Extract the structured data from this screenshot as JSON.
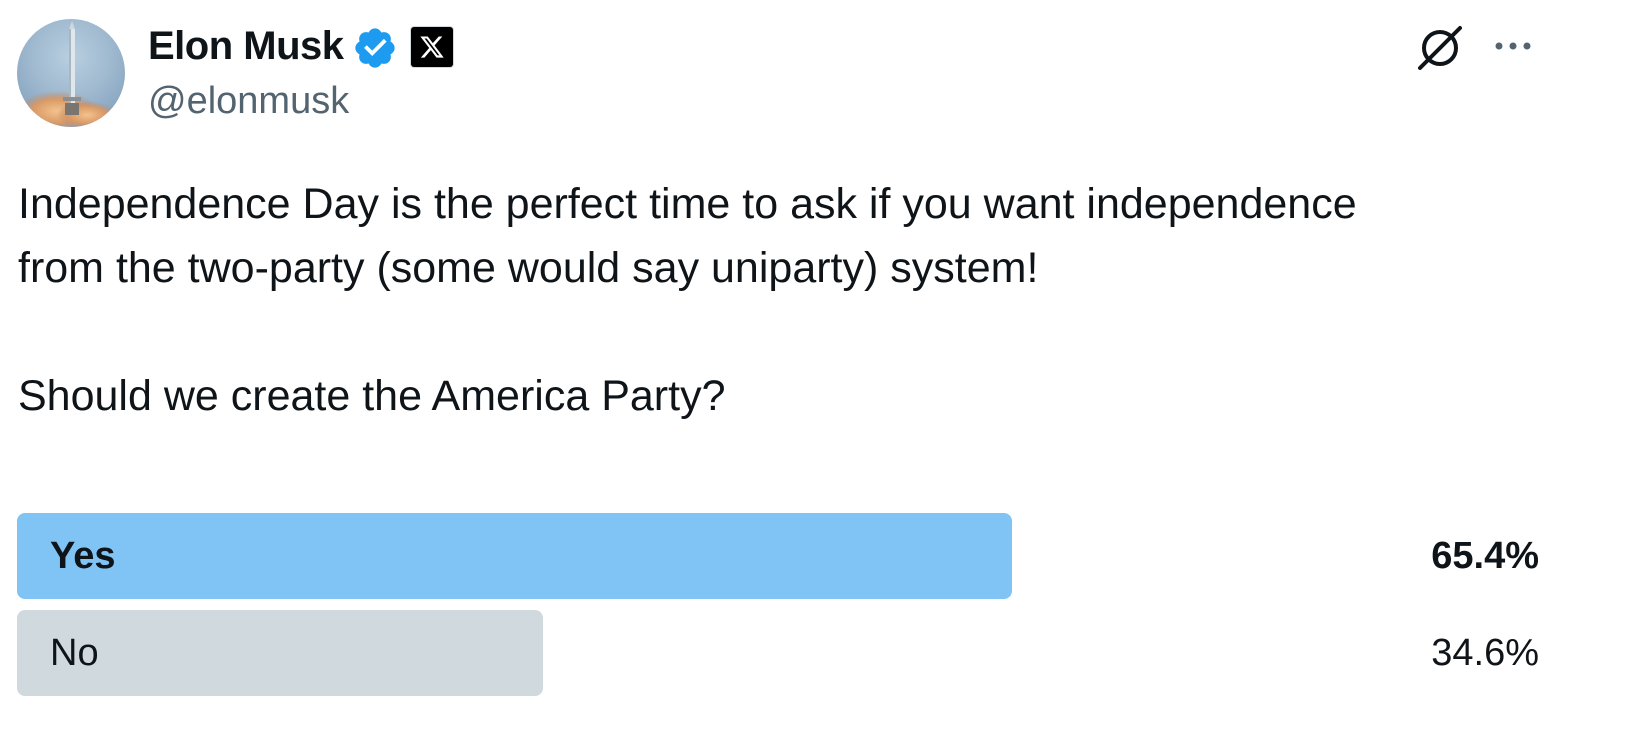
{
  "author": {
    "display_name": "Elon Musk",
    "handle": "@elonmusk",
    "avatar_icon": "rocket-launch-avatar",
    "verified_icon": "verified-badge-icon",
    "affiliation_icon": "x-logo-icon"
  },
  "actions": {
    "grok_icon": "grok-icon",
    "more_icon": "more-horizontal-icon"
  },
  "tweet": {
    "text_line1": "Independence Day is the perfect time to ask if you want independence",
    "text_line2": "from the two-party (some would say uniparty) system!",
    "text_line3": "",
    "text_line4": "Should we create the America Party?"
  },
  "poll": {
    "options": [
      {
        "label": "Yes",
        "percent_text": "65.4%",
        "percent": 65.4,
        "winner": true
      },
      {
        "label": "No",
        "percent_text": "34.6%",
        "percent": 34.6,
        "winner": false
      }
    ]
  },
  "colors": {
    "winner_bar": "#7fc4f5",
    "other_bar": "#cfd9de",
    "verified": "#1d9bf0",
    "text_primary": "#0f1419",
    "text_secondary": "#536471"
  }
}
